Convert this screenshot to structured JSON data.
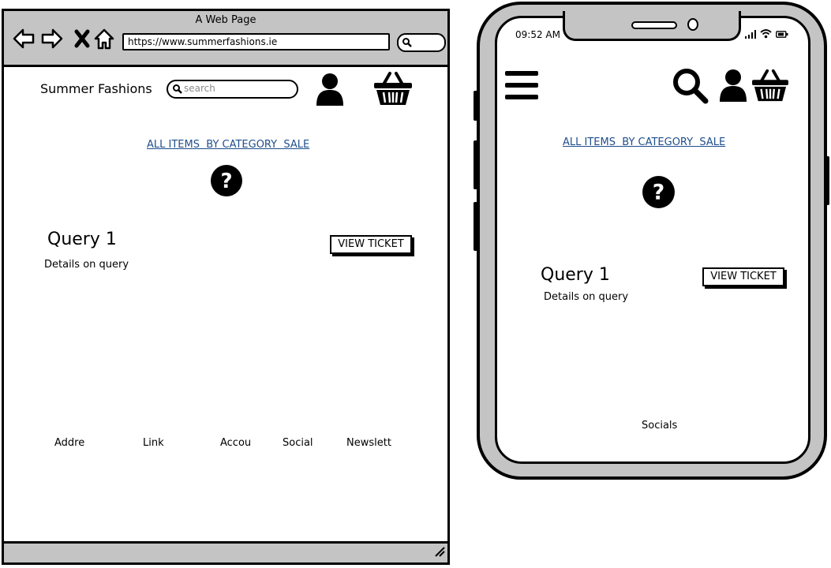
{
  "browser": {
    "window_title": "A Web Page",
    "url": "https://www.summerfashions.ie",
    "header": {
      "site_title": "Summer Fashions",
      "search_placeholder": "search"
    },
    "nav": {
      "text": "ALL ITEMS  BY CATEGORY  SALE"
    },
    "query": {
      "title": "Query 1",
      "details": "Details on query",
      "button": "VIEW TICKET"
    },
    "footer": [
      "Addre",
      "Link",
      "Accou",
      "Social",
      "Newslett"
    ]
  },
  "phone": {
    "status": {
      "time": "09:52 AM"
    },
    "nav": {
      "text": "ALL ITEMS  BY CATEGORY  SALE"
    },
    "query": {
      "title": "Query 1",
      "details": "Details on query",
      "button": "VIEW TICKET"
    },
    "footer": {
      "socials": "Socials"
    }
  },
  "icons": [
    "back-arrow-icon",
    "forward-arrow-icon",
    "close-icon",
    "home-icon",
    "search-icon",
    "user-icon",
    "basket-icon",
    "help-icon",
    "menu-icon",
    "signal-icon",
    "wifi-icon",
    "battery-icon",
    "resize-grip-icon"
  ]
}
